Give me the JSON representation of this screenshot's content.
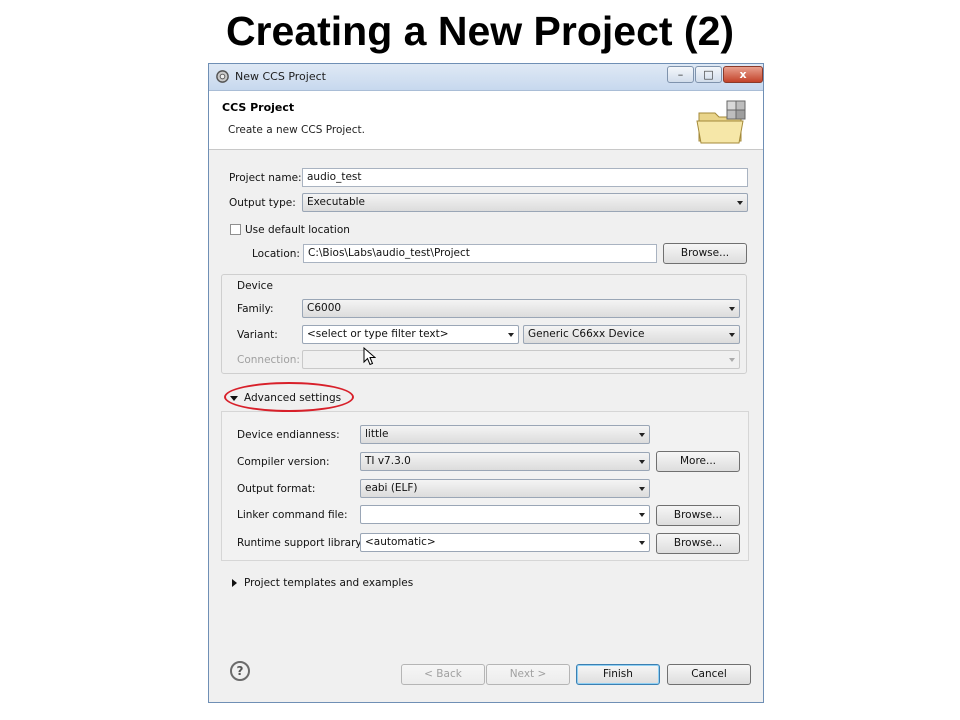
{
  "slide": {
    "title": "Creating a New Project (2)"
  },
  "window": {
    "title": "New CCS Project",
    "minimize": "–",
    "maximize": "□",
    "close": "x"
  },
  "banner": {
    "heading": "CCS Project",
    "subtitle": "Create a new CCS Project."
  },
  "project": {
    "name_label": "Project name:",
    "name_value": "audio_test",
    "output_type_label": "Output type:",
    "output_type_value": "Executable",
    "use_default_label": "Use default location",
    "use_default_checked": false,
    "location_label": "Location:",
    "location_value": "C:\\Bios\\Labs\\audio_test\\Project",
    "browse_label": "Browse..."
  },
  "device": {
    "group_label": "Device",
    "family_label": "Family:",
    "family_value": "C6000",
    "variant_label": "Variant:",
    "variant_filter_placeholder": "<select or type filter text>",
    "variant_value": "Generic C66xx Device",
    "connection_label": "Connection:",
    "connection_value": ""
  },
  "advanced": {
    "toggle_label": "Advanced settings",
    "expanded": true,
    "highlight_color": "#d8202a",
    "endianness_label": "Device endianness:",
    "endianness_value": "little",
    "compiler_label": "Compiler version:",
    "compiler_value": "TI v7.3.0",
    "more_label": "More...",
    "output_format_label": "Output format:",
    "output_format_value": "eabi (ELF)",
    "linker_label": "Linker command file:",
    "linker_value": "",
    "linker_browse": "Browse...",
    "rts_label": "Runtime support library:",
    "rts_value": "<automatic>",
    "rts_browse": "Browse..."
  },
  "templates": {
    "toggle_label": "Project templates and examples",
    "expanded": false
  },
  "footer": {
    "help_icon": "?",
    "back": "< Back",
    "next": "Next >",
    "finish": "Finish",
    "cancel": "Cancel"
  }
}
